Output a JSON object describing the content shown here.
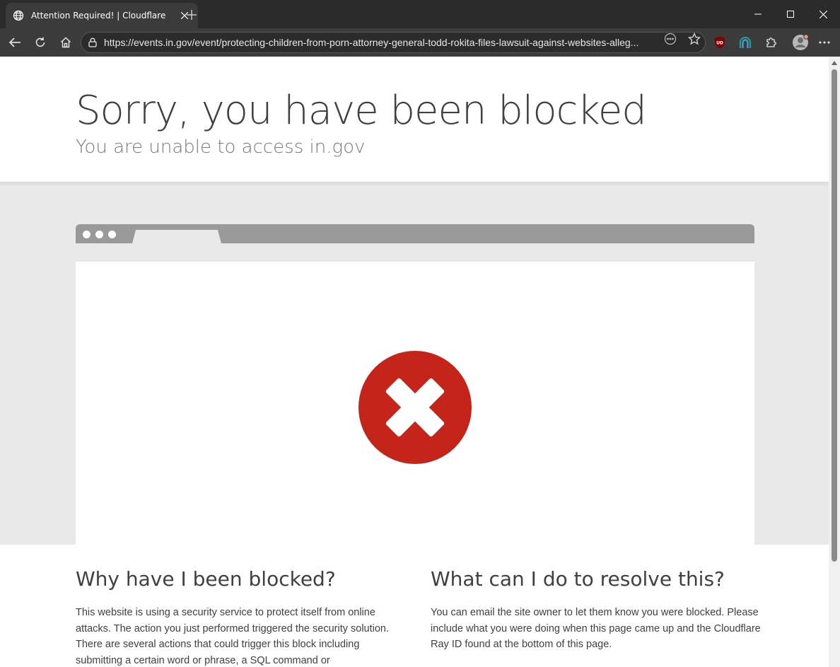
{
  "browser": {
    "tab_title": "Attention Required! | Cloudflare",
    "url": "https://events.in.gov/event/protecting-children-from-porn-attorney-general-todd-rokita-files-lawsuit-against-websites-alleg...",
    "extensions": [
      "ublock-origin-icon",
      "rainbow-extension-icon",
      "puzzle-icon",
      "profile-avatar"
    ]
  },
  "page": {
    "title": "Sorry, you have been blocked",
    "subtitle": "You are unable to access in.gov",
    "why": {
      "heading": "Why have I been blocked?",
      "body": "This website is using a security service to protect itself from online attacks. The action you just performed triggered the security solution. There are several actions that could trigger this block including submitting a certain word or phrase, a SQL command or"
    },
    "resolve": {
      "heading": "What can I do to resolve this?",
      "body": "You can email the site owner to let them know you were blocked. Please include what you were doing when this page came up and the Cloudflare Ray ID found at the bottom of this page."
    }
  },
  "colors": {
    "error_red": "#c4241a",
    "band_grey": "#e9e9e9",
    "chrome_dark": "#2b2b2b"
  }
}
